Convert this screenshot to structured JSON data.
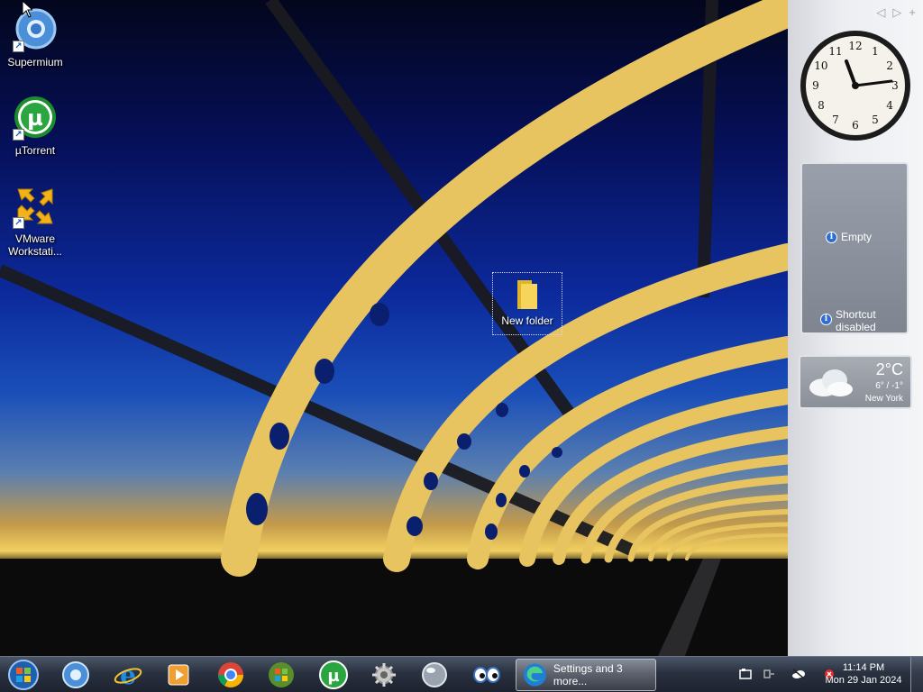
{
  "desktop": {
    "icons": [
      {
        "label": "Supermium",
        "icon": "supermium-icon"
      },
      {
        "label": "µTorrent",
        "icon": "utorrent-icon"
      },
      {
        "label": "VMware Workstati...",
        "icon": "vmware-icon"
      }
    ],
    "folder": {
      "label": "New folder"
    }
  },
  "sidebar": {
    "controls": [
      "◁",
      "▷",
      "+"
    ],
    "clock": {
      "numbers": [
        "12",
        "1",
        "2",
        "3",
        "4",
        "5",
        "6",
        "7",
        "8",
        "9",
        "10",
        "11"
      ]
    },
    "empty_gadget": {
      "empty_label": "Empty",
      "shortcut_label_1": "Shortcut",
      "shortcut_label_2": "disabled"
    },
    "weather": {
      "temp": "2°C",
      "range": "6° / -1°",
      "city": "New York"
    }
  },
  "taskbar": {
    "pinned": [
      "start-orb",
      "supermium",
      "internet-explorer",
      "media-player",
      "chrome",
      "windows-flag",
      "utorrent",
      "gear-app",
      "orb-app",
      "eyes-app"
    ],
    "active_task": {
      "label": "Settings and 3 more..."
    },
    "clock": {
      "time": "11:14 PM",
      "date": "Mon 29 Jan 2024"
    }
  },
  "colors": {
    "taskbar": "#2a3140",
    "sidebar": "#eceef2",
    "accent": "#2f6fd4"
  }
}
